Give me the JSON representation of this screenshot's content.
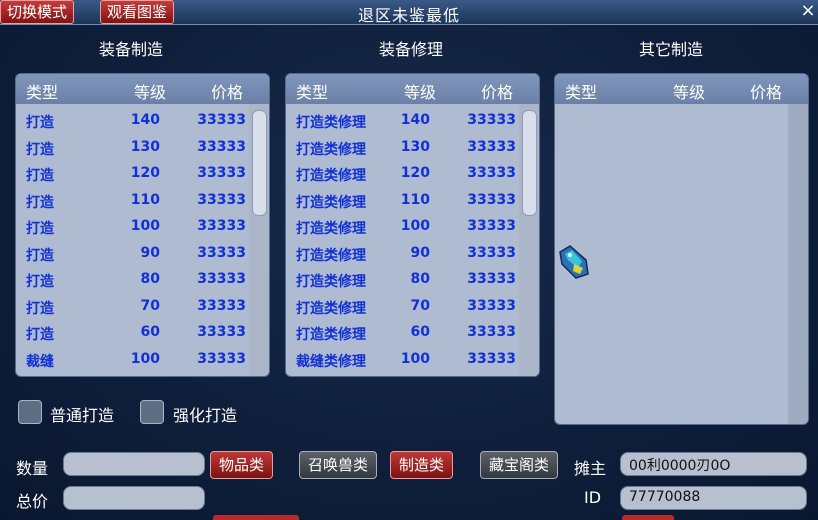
{
  "title": "退区未鉴最低",
  "top_buttons": {
    "switch_mode": "切换模式",
    "view_catalog": "观看图鉴"
  },
  "close_icon": "×",
  "sections": {
    "equip_make": "装备制造",
    "equip_repair": "装备修理",
    "other_make": "其它制造"
  },
  "columns": {
    "type": "类型",
    "level": "等级",
    "price": "价格"
  },
  "equip_make_rows": [
    {
      "type": "打造",
      "level": "140",
      "price": "33333"
    },
    {
      "type": "打造",
      "level": "130",
      "price": "33333"
    },
    {
      "type": "打造",
      "level": "120",
      "price": "33333"
    },
    {
      "type": "打造",
      "level": "110",
      "price": "33333"
    },
    {
      "type": "打造",
      "level": "100",
      "price": "33333"
    },
    {
      "type": "打造",
      "level": "90",
      "price": "33333"
    },
    {
      "type": "打造",
      "level": "80",
      "price": "33333"
    },
    {
      "type": "打造",
      "level": "70",
      "price": "33333"
    },
    {
      "type": "打造",
      "level": "60",
      "price": "33333"
    },
    {
      "type": "裁缝",
      "level": "100",
      "price": "33333"
    }
  ],
  "equip_repair_rows": [
    {
      "type": "打造类修理",
      "level": "140",
      "price": "33333"
    },
    {
      "type": "打造类修理",
      "level": "130",
      "price": "33333"
    },
    {
      "type": "打造类修理",
      "level": "120",
      "price": "33333"
    },
    {
      "type": "打造类修理",
      "level": "110",
      "price": "33333"
    },
    {
      "type": "打造类修理",
      "level": "100",
      "price": "33333"
    },
    {
      "type": "打造类修理",
      "level": "90",
      "price": "33333"
    },
    {
      "type": "打造类修理",
      "level": "80",
      "price": "33333"
    },
    {
      "type": "打造类修理",
      "level": "70",
      "price": "33333"
    },
    {
      "type": "打造类修理",
      "level": "60",
      "price": "33333"
    },
    {
      "type": "裁缝类修理",
      "level": "100",
      "price": "33333"
    }
  ],
  "checkboxes": {
    "normal": "普通打造",
    "enhanced": "强化打造"
  },
  "bottom": {
    "quantity_label": "数量",
    "total_label": "总价",
    "quantity_value": "",
    "total_value": "",
    "tabs": [
      "物品类",
      "召唤兽类",
      "制造类",
      "藏宝阁类"
    ],
    "owner_label": "摊主",
    "owner_value": "00利0000刃0O",
    "id_label": "ID",
    "id_value": "77770088"
  },
  "icons": {
    "item": "gem-item-icon"
  },
  "colors": {
    "accent_red": "#c03838",
    "row_text": "#1131d6",
    "panel_bg": "#aebbd1"
  }
}
